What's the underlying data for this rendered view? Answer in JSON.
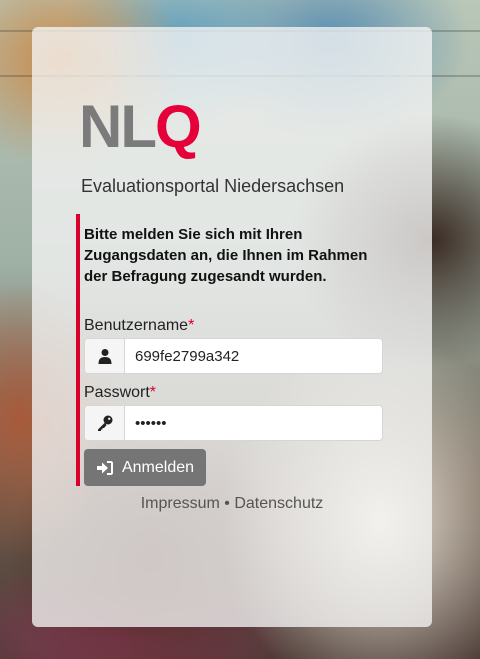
{
  "logo": {
    "part1": "NL",
    "part2": "Q",
    "accent_color": "#e5003a"
  },
  "portal_title": "Evaluationsportal Niedersachsen",
  "intro_text": "Bitte melden Sie sich mit Ihren Zugangsdaten an, die Ihnen im Rahmen der Befragung zugesandt wurden.",
  "username": {
    "label": "Benutzername",
    "required_marker": "*",
    "value": "699fe2799a342",
    "icon": "user-icon"
  },
  "password": {
    "label": "Passwort",
    "required_marker": "*",
    "value": "••••••",
    "icon": "key-icon"
  },
  "login_button": {
    "label": "Anmelden",
    "icon": "sign-in-icon"
  },
  "footer": {
    "impressum": "Impressum",
    "separator": "•",
    "datenschutz": "Datenschutz"
  }
}
